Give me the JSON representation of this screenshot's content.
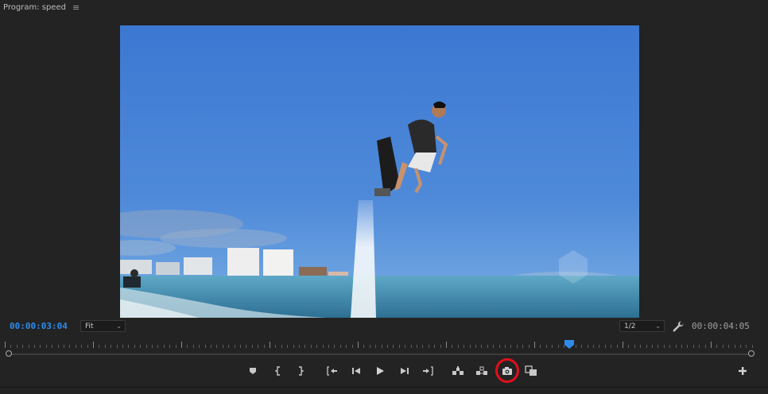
{
  "panel": {
    "title": "Program: speed",
    "menu_icon": "hamburger-menu-icon"
  },
  "viewer": {
    "content": "program-monitor-frame"
  },
  "timecode": {
    "current": "00:00:03:04",
    "duration": "00:00:04:05",
    "current_color": "#2d8ceb"
  },
  "zoom": {
    "selected": "Fit"
  },
  "resolution": {
    "selected": "1/2"
  },
  "playhead": {
    "position_fraction": 0.75
  },
  "transport": {
    "buttons": [
      "add-marker-icon",
      "mark-in-icon",
      "mark-out-icon",
      "go-to-in-icon",
      "step-back-icon",
      "play-icon",
      "step-forward-icon",
      "go-to-out-icon",
      "lift-icon",
      "extract-icon",
      "export-frame-icon",
      "comparison-view-icon"
    ],
    "highlighted": "export-frame-icon",
    "highlight_color": "#e0101a"
  },
  "add_button_icon": "plus-icon"
}
